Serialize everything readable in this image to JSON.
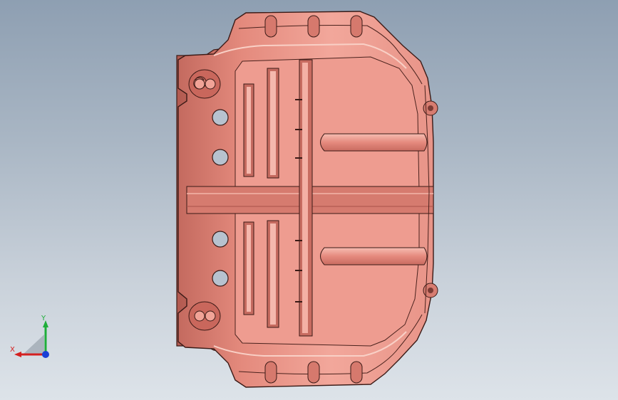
{
  "viewport": {
    "background_top": "#8e9fb2",
    "background_bottom": "#dde3e9"
  },
  "model": {
    "part_color": "#e0877a",
    "shade_color": "#b85c52",
    "highlight_color": "#f8c2b8",
    "edge_color": "#3a1a16"
  },
  "triad": {
    "x_label": "X",
    "y_label": "Y",
    "x_color": "#d42020",
    "y_color": "#1fae3a",
    "z_color": "#1a3fd6"
  }
}
